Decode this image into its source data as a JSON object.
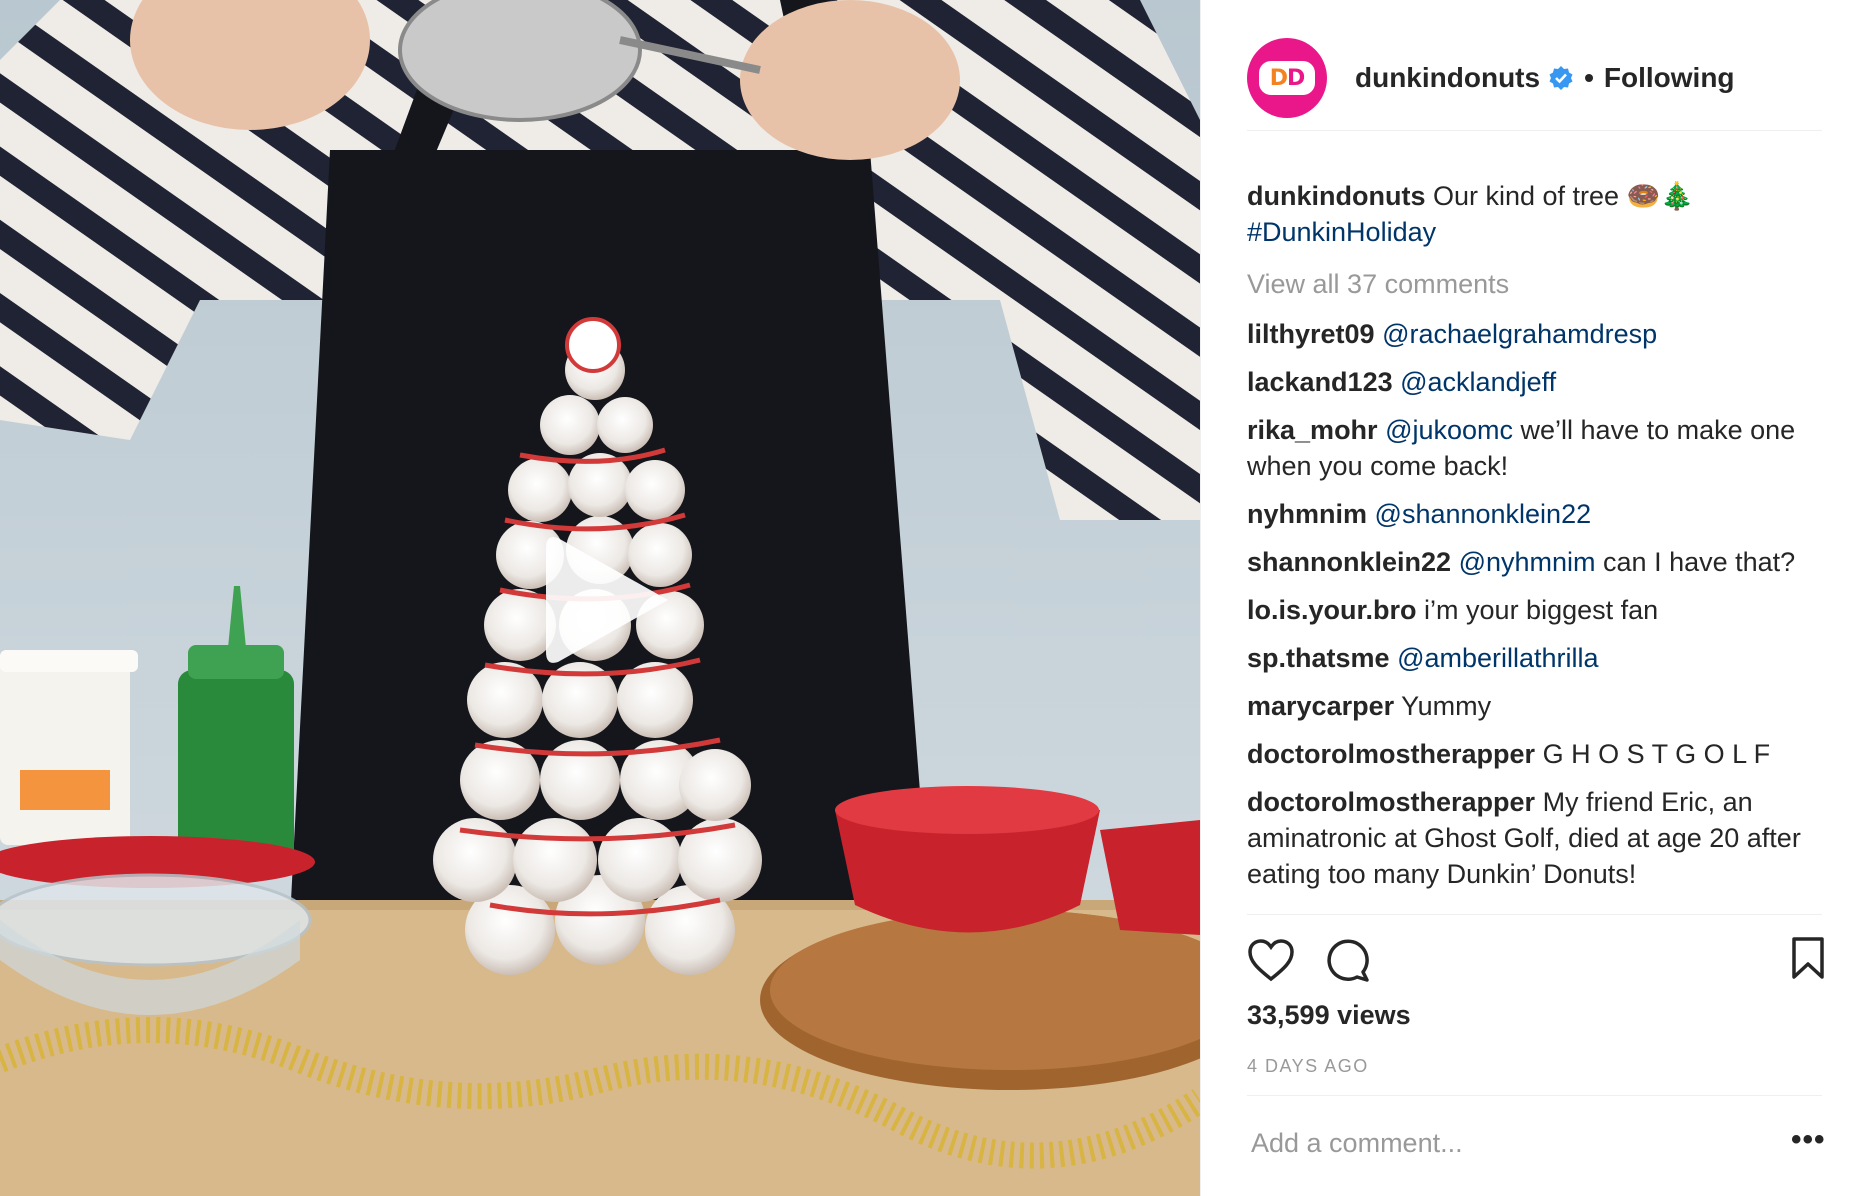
{
  "post": {
    "username": "dunkindonuts",
    "follow_state": "Following",
    "separator": "•",
    "avatar_text": "DD"
  },
  "caption": {
    "username": "dunkindonuts",
    "text": "Our kind of tree 🍩🎄",
    "hashtag": "#DunkinHoliday"
  },
  "view_all_comments": "View all 37 comments",
  "comments": [
    {
      "user": "lilthyret09",
      "mention": "@rachaelgrahamdresp",
      "text": ""
    },
    {
      "user": "lackand123",
      "mention": "@acklandjeff",
      "text": ""
    },
    {
      "user": "rika_mohr",
      "mention": "@jukoomc",
      "text": " we’ll have to make one when you come back!"
    },
    {
      "user": "nyhmnim",
      "mention": "@shannonklein22",
      "text": ""
    },
    {
      "user": "shannonklein22",
      "mention": "@nyhmnim",
      "text": " can I have that?"
    },
    {
      "user": "lo.is.your.bro",
      "mention": "",
      "text": "i’m your biggest fan"
    },
    {
      "user": "sp.thatsme",
      "mention": "@amberillathrilla",
      "text": ""
    },
    {
      "user": "marycarper",
      "mention": "",
      "text": "Yummy"
    },
    {
      "user": "doctorolmostherapper",
      "mention": "",
      "text": "G H O S T G O L F"
    },
    {
      "user": "doctorolmostherapper",
      "mention": "",
      "text": "My friend Eric, an aminatronic at Ghost Golf, died at age 20 after eating too many Dunkin’ Donuts!"
    }
  ],
  "stats": {
    "views": "33,599 views",
    "date": "4 DAYS AGO"
  },
  "add_comment_placeholder": "Add a comment...",
  "more_label": "•••",
  "icons": {
    "like": "heart-icon",
    "comment": "comment-bubble-icon",
    "save": "bookmark-icon",
    "verified": "verified-badge-icon",
    "play": "play-icon"
  },
  "colors": {
    "brand_pink": "#e9178a",
    "brand_orange": "#f58220",
    "verified_blue": "#3897f0",
    "link_blue": "#003569"
  }
}
